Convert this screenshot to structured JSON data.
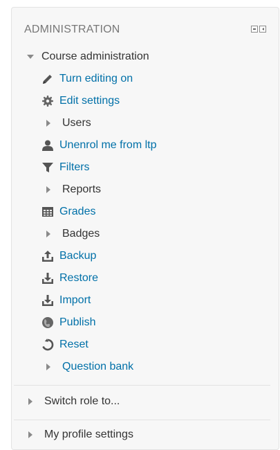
{
  "block": {
    "title": "ADMINISTRATION"
  },
  "course_admin": {
    "label": "Course administration",
    "items": [
      {
        "label": "Turn editing on",
        "icon": "pencil-icon"
      },
      {
        "label": "Edit settings",
        "icon": "gear-icon"
      },
      {
        "label": "Users",
        "icon": "expand-arrow-icon"
      },
      {
        "label": "Unenrol me from ltp",
        "icon": "user-icon"
      },
      {
        "label": "Filters",
        "icon": "filter-icon"
      },
      {
        "label": "Reports",
        "icon": "expand-arrow-icon"
      },
      {
        "label": "Grades",
        "icon": "grades-table-icon"
      },
      {
        "label": "Badges",
        "icon": "expand-arrow-icon"
      },
      {
        "label": "Backup",
        "icon": "backup-upload-icon"
      },
      {
        "label": "Restore",
        "icon": "restore-download-icon"
      },
      {
        "label": "Import",
        "icon": "import-download-icon"
      },
      {
        "label": "Publish",
        "icon": "globe-icon"
      },
      {
        "label": "Reset",
        "icon": "reset-icon"
      },
      {
        "label": "Question bank",
        "icon": "expand-arrow-icon"
      }
    ]
  },
  "bottom_items": [
    {
      "label": "Switch role to..."
    },
    {
      "label": "My profile settings"
    }
  ],
  "colors": {
    "link": "#0070a8",
    "text": "#333333",
    "header": "#777777",
    "panel_bg": "#f7f7f7"
  }
}
